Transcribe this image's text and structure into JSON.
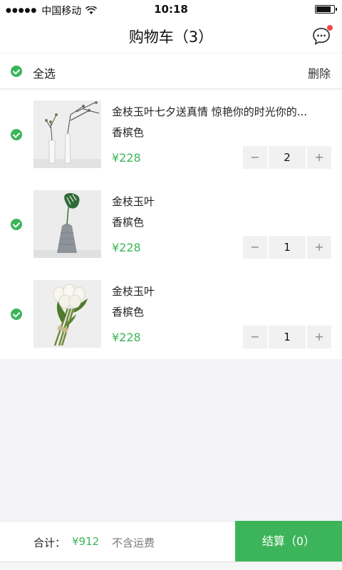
{
  "status_bar": {
    "signal": "●●●●●",
    "carrier": "中国移动",
    "time": "10:18",
    "battery_level": 0.85
  },
  "navbar": {
    "title": "购物车（3）",
    "message_icon": "chat-bubble-icon",
    "has_notification": true
  },
  "select_all": {
    "label": "全选",
    "checked": true,
    "delete_label": "删除"
  },
  "items": [
    {
      "name": "金枝玉叶七夕送真情 惊艳你的时光你的...",
      "spec": "香槟色",
      "price": "¥228",
      "quantity": "2",
      "checked": true,
      "image": "vases-with-branches"
    },
    {
      "name": "金枝玉叶",
      "spec": "香槟色",
      "price": "¥228",
      "quantity": "1",
      "checked": true,
      "image": "monstera-leaf-vase"
    },
    {
      "name": "金枝玉叶",
      "spec": "香槟色",
      "price": "¥228",
      "quantity": "1",
      "checked": true,
      "image": "white-tulip-bouquet"
    }
  ],
  "stepper": {
    "minus": "−",
    "plus": "+"
  },
  "bottom_bar": {
    "total_label": "合计：",
    "total_value": "¥912",
    "shipping_note": "不含运费",
    "checkout_label": "结算（0）"
  },
  "colors": {
    "accent": "#3cb55a",
    "badge": "#f04a4a",
    "background": "#f4f4f8"
  }
}
